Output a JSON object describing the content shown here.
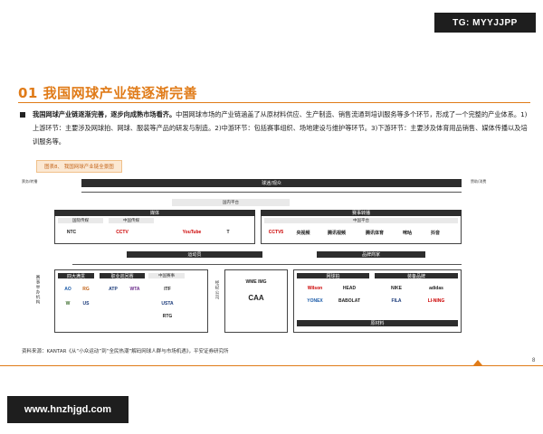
{
  "watermark_top": "TG: MYYJJPP",
  "watermark_bottom": "www.hnzhjgd.com",
  "heading": "01  我国网球产业链逐渐完善",
  "paragraph_bold": "我国网球产业链逐渐完善，逐步向成熟市场看齐。",
  "paragraph_body": "中国网球市场的产业链涵盖了从原材料供应、生产制造、销售流通到培训服务等多个环节，形成了一个完整的产业体系。1)上游环节：主要涉及网球拍、网球、服装等产品的研发与制造。2)中游环节：包括赛事组织、场地建设与维护等环节。3)下游环节：主要涉及体育用品销售、媒体传播以及培训服务等。",
  "figure_caption": "图表8、 我国网球产业链全景图",
  "figure": {
    "top_band": "球迷/观众",
    "left_top_note": "票务/转播",
    "right_top_note": "赞助/消费",
    "domestic": "国内平台",
    "media_left": "媒体",
    "media_left_sub_a": "国际传媒",
    "media_left_sub_b": "中国传媒",
    "media_right": "赛事转播",
    "media_right_sub": "中国平台",
    "logos_media": [
      "NTC",
      "CCTV",
      "YouTube",
      "T",
      "CCTV5",
      "央视频",
      "腾讯视频",
      "腾讯体育",
      "咪咕",
      "抖音"
    ],
    "athletes": "运动员",
    "brand_partners": "品牌商家",
    "tours": "四大满贯",
    "pro_tour": "职业巡回赛",
    "china_events": "中国赛事",
    "event_logos": [
      "AO",
      "RG",
      "W",
      "US",
      "ATP",
      "WTA",
      "ITF",
      "RTG",
      "USTA"
    ],
    "agencies": [
      "WME IMG",
      "CAA"
    ],
    "equipment": "网球拍",
    "apparel": "装备品牌",
    "racket_brands": [
      "Wilson",
      "HEAD",
      "YONEX",
      "BABOLAT"
    ],
    "apparel_brands": [
      "NIKE",
      "adidas",
      "FILA",
      "LI-NING"
    ],
    "raw_material": "原材料",
    "left_vertical": "赛事举办机构",
    "right_vertical": "经纪公司"
  },
  "source_note": "资料来源：KANTAR《从“小众运动”到“全民热潮”解码网球人群与市场机遇》，平安证券研究所",
  "page_number": "8"
}
